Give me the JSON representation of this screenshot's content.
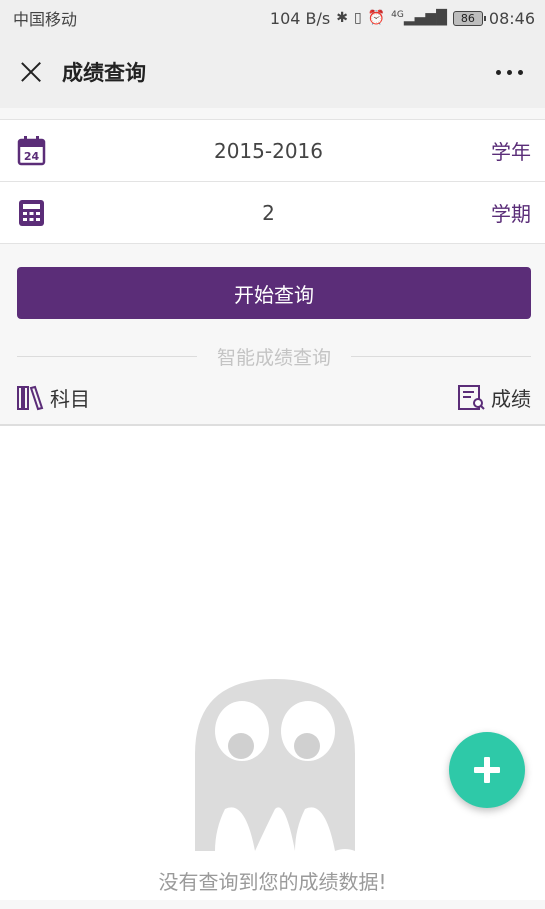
{
  "status_bar": {
    "carrier": "中国移动",
    "speed": "104 B/s",
    "network": "4G",
    "battery": "86",
    "time": "08:46"
  },
  "nav": {
    "title": "成绩查询"
  },
  "form": {
    "year": {
      "value": "2015-2016",
      "label": "学年",
      "calendar_day": "24"
    },
    "term": {
      "value": "2",
      "label": "学期"
    }
  },
  "query_button": "开始查询",
  "divider_text": "智能成绩查询",
  "list_header": {
    "subject": "科目",
    "score": "成绩"
  },
  "empty_text": "没有查询到您的成绩数据!",
  "colors": {
    "accent": "#5b2d78",
    "fab": "#2ec9a8"
  }
}
